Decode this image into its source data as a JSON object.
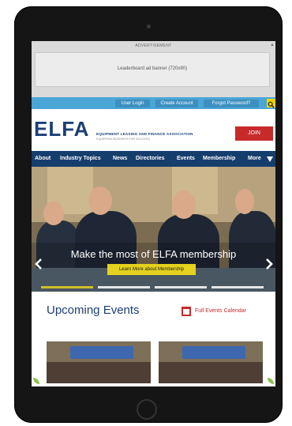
{
  "ad": {
    "label": "ADVERTISEMENT",
    "text": "Leaderboard ad banner (720x90)"
  },
  "topbar": {
    "user_login": "User Login",
    "create_account": "Create Account",
    "forgot_password": "Forgot Password?",
    "search_icon": "search-icon"
  },
  "header": {
    "logo": "ELFA",
    "org_name": "EQUIPMENT LEASING AND FINANCE ASSOCIATION",
    "tagline": "EQUIPPING BUSINESS FOR SUCCESS",
    "join": "JOIN"
  },
  "nav": {
    "items": [
      "About",
      "Industry Topics",
      "News",
      "Directories",
      "Events",
      "Membership",
      "More"
    ],
    "more_icon": "triangle-down-icon"
  },
  "hero": {
    "title": "Make the most of ELFA membership",
    "button": "Learn More about Membership",
    "prev_icon": "chevron-left-icon",
    "next_icon": "chevron-right-icon"
  },
  "events": {
    "title": "Upcoming Events",
    "calendar_link": "Full Events Calendar",
    "calendar_icon": "calendar-icon"
  },
  "colors": {
    "navy": "#163e6d",
    "topbar": "#4aa6d6",
    "join_red": "#c82a2a",
    "cta_yellow": "#e5d21e"
  }
}
